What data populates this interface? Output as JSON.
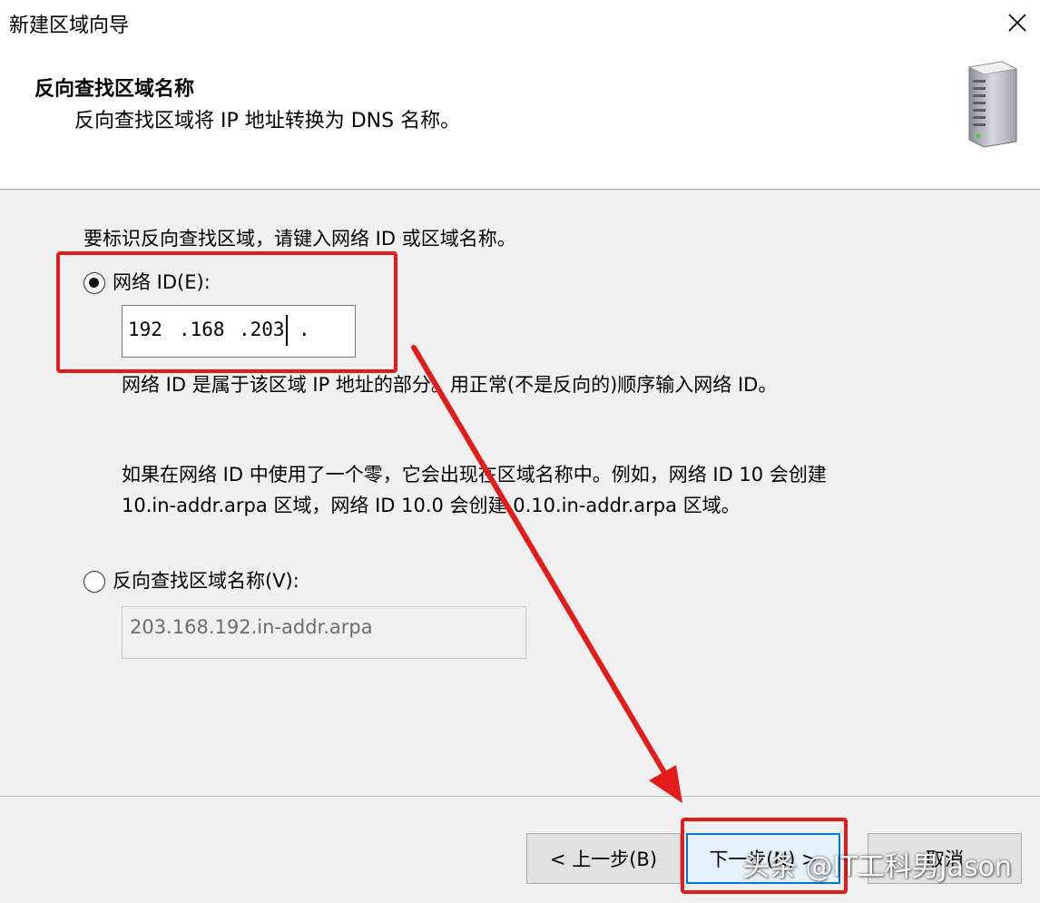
{
  "window": {
    "title": "新建区域向导"
  },
  "header": {
    "title": "反向查找区域名称",
    "subtitle": "反向查找区域将 IP 地址转换为 DNS 名称。"
  },
  "body": {
    "instruction": "要标识反向查找区域，请键入网络 ID 或区域名称。",
    "network_id": {
      "label": "网络 ID(E):",
      "selected": true,
      "octets": [
        "192",
        ".168",
        ".203",
        "."
      ]
    },
    "network_id_desc": "网络 ID 是属于该区域 IP 地址的部分。用正常(不是反向的)顺序输入网络 ID。",
    "zero_note_line1": "如果在网络 ID 中使用了一个零，它会出现在区域名称中。例如，网络 ID 10 会创建",
    "zero_note_line2": "10.in-addr.arpa 区域，网络 ID 10.0 会创建 0.10.in-addr.arpa 区域。",
    "zone_name": {
      "label": "反向查找区域名称(V):",
      "selected": false,
      "value": "203.168.192.in-addr.arpa"
    }
  },
  "footer": {
    "back_label": "< 上一步(B)",
    "next_label": "下一步(N) >",
    "cancel_label": "取消"
  },
  "watermark": "头条 @IT工科男Jason",
  "colors": {
    "annotation": "#e41b1b",
    "focus": "#0078d7"
  },
  "icons": [
    "close-icon",
    "server-icon",
    "radio-icon"
  ]
}
